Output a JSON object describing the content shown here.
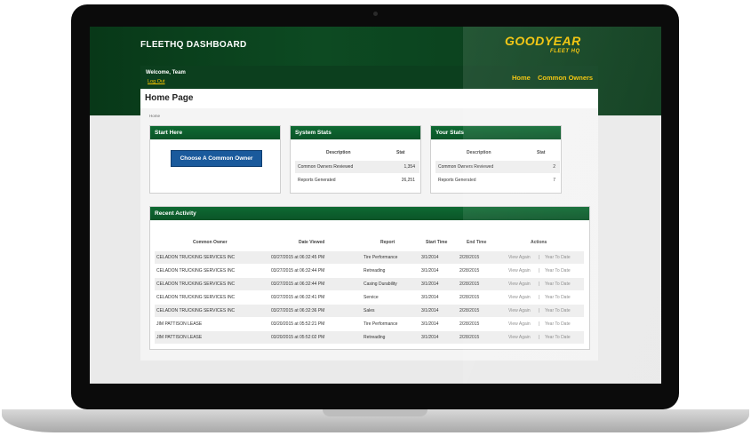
{
  "header": {
    "app_title": "FLEETHQ DASHBOARD",
    "logo": "GOODYEAR",
    "logo_sub": "FLEET HQ"
  },
  "userbar": {
    "welcome": "Welcome, Team",
    "logout": "Log Out"
  },
  "nav": {
    "home": "Home",
    "common_owners": "Common Owners"
  },
  "page": {
    "title": "Home Page",
    "breadcrumb": "Home"
  },
  "start_here": {
    "title": "Start Here",
    "button": "Choose A Common Owner"
  },
  "system_stats": {
    "title": "System Stats",
    "col_desc": "Description",
    "col_stat": "Stat",
    "rows": [
      {
        "desc": "Common Owners Reviewed",
        "stat": "1,354"
      },
      {
        "desc": "Reports Generated",
        "stat": "26,251"
      }
    ]
  },
  "your_stats": {
    "title": "Your Stats",
    "col_desc": "Description",
    "col_stat": "Stat",
    "rows": [
      {
        "desc": "Common Owners Reviewed",
        "stat": "2"
      },
      {
        "desc": "Reports Generated",
        "stat": "7"
      }
    ]
  },
  "recent": {
    "title": "Recent Activity",
    "headers": {
      "owner": "Common Owner",
      "date": "Date Viewed",
      "report": "Report",
      "start": "Start Time",
      "end": "End Time",
      "actions": "Actions"
    },
    "view_again": "View Again",
    "sep": "|",
    "year_to_date": "Year To Date",
    "rows": [
      {
        "owner": "CELADON TRUCKING SERVICES INC",
        "date": "03/27/2015 at 06:32:45 PM",
        "report": "Tire Performance",
        "start": "3/1/2014",
        "end": "2/28/2015"
      },
      {
        "owner": "CELADON TRUCKING SERVICES INC",
        "date": "03/27/2015 at 06:32:44 PM",
        "report": "Retreading",
        "start": "3/1/2014",
        "end": "2/28/2015"
      },
      {
        "owner": "CELADON TRUCKING SERVICES INC",
        "date": "03/27/2015 at 06:32:44 PM",
        "report": "Casing Durability",
        "start": "3/1/2014",
        "end": "2/28/2015"
      },
      {
        "owner": "CELADON TRUCKING SERVICES INC",
        "date": "03/27/2015 at 06:32:41 PM",
        "report": "Service",
        "start": "3/1/2014",
        "end": "2/28/2015"
      },
      {
        "owner": "CELADON TRUCKING SERVICES INC",
        "date": "03/27/2015 at 06:32:36 PM",
        "report": "Sales",
        "start": "3/1/2014",
        "end": "2/28/2015"
      },
      {
        "owner": "JIM PATTISON LEASE",
        "date": "03/20/2015 at 05:52:21 PM",
        "report": "Tire Performance",
        "start": "3/1/2014",
        "end": "2/28/2015"
      },
      {
        "owner": "JIM PATTISON LEASE",
        "date": "03/20/2015 at 05:52:02 PM",
        "report": "Retreading",
        "start": "3/1/2014",
        "end": "2/28/2015"
      }
    ]
  }
}
